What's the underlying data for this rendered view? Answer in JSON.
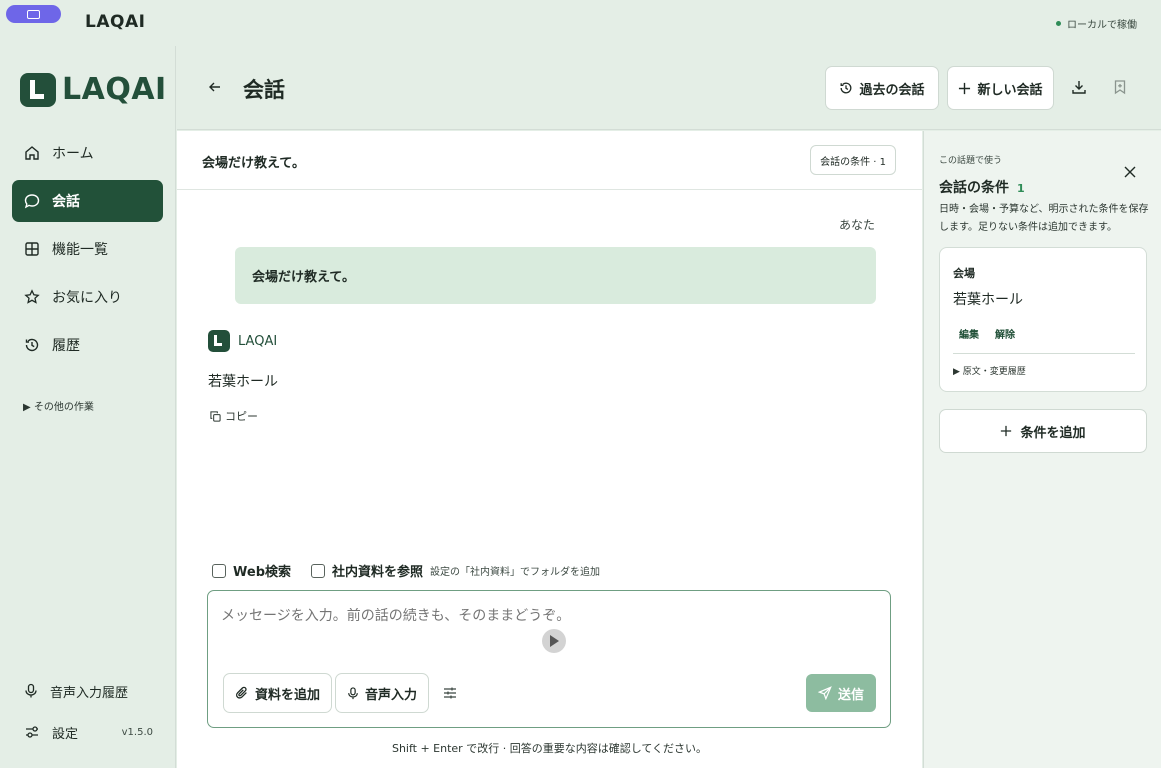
{
  "titlebar": {
    "app_name": "LAQAI",
    "status": "ローカルで稼働"
  },
  "sidebar": {
    "logo_text": "LAQAI",
    "items": [
      {
        "label": "ホーム",
        "icon": "home-icon"
      },
      {
        "label": "会話",
        "icon": "chat-bubble-icon",
        "active": true
      },
      {
        "label": "機能一覧",
        "icon": "grid-icon"
      },
      {
        "label": "お気に入り",
        "icon": "star-icon"
      },
      {
        "label": "履歴",
        "icon": "history-icon"
      }
    ],
    "other_work": "▶ その他の作業",
    "voice_history": "音声入力履歴",
    "settings": "設定",
    "version": "v1.5.0"
  },
  "header": {
    "title": "会話",
    "past_button": "過去の会話",
    "new_button": "新しい会話"
  },
  "chat": {
    "topic": "会場だけ教えて。",
    "condition_chip": "会話の条件 · 1",
    "you_label": "あなた",
    "user_message": "会場だけ教えて。",
    "ai_name": "LAQAI",
    "ai_answer": "若葉ホール",
    "copy_label": "コピー",
    "web_search": "Web検索",
    "internal_docs": "社内資料を参照",
    "internal_hint": "設定の「社内資料」でフォルダを追加",
    "input_placeholder": "メッセージを入力。前の話の続きも、そのままどうぞ。",
    "attach_button": "資料を追加",
    "voice_button": "音声入力",
    "send_button": "送信",
    "footer_note": "Shift + Enter で改行 · 回答の重要な内容は確認してください。"
  },
  "conditions_panel": {
    "caption": "この話題で使う",
    "title": "会話の条件",
    "count": "1",
    "description": "日時・会場・予算など、明示された条件を保存します。足りない条件は追加できます。",
    "card": {
      "label": "会場",
      "value": "若葉ホール",
      "edit": "編集",
      "remove": "解除",
      "history": "▶ 原文・変更履歴"
    },
    "add_button": "条件を追加"
  },
  "colors": {
    "accent": "#225139",
    "background": "#e4eee6",
    "user_bubble": "#d9ebdd",
    "send_button": "#8dbca0"
  }
}
